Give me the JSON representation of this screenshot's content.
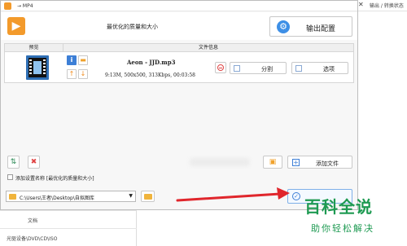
{
  "window": {
    "title": "→ MP4"
  },
  "background_app": {
    "top_right_text": "输出 / 转换状态",
    "left_items": [
      "文档",
      "光驱设备\\DVD\\CD\\ISO"
    ]
  },
  "header": {
    "preset_name": "最优化的质量和大小",
    "output_config_label": "输出配置"
  },
  "list": {
    "columns": [
      "预览",
      "文件信息"
    ],
    "rows": [
      {
        "file_name": "Aeon - JJD.mp3",
        "meta": "9:13M, 500x500, 313Kbps, 00:03:58",
        "split_label": "分割",
        "options_label": "选项"
      }
    ]
  },
  "toolbar": {
    "add_file_label": "添加文件"
  },
  "save_preset": {
    "label": "添加设置名称 [最优化的质量和大小]",
    "checked": false
  },
  "output": {
    "directory": "C:\\Users\\王者\\Desktop\\自拟图库"
  },
  "watermark": {
    "main": "百科全说",
    "sub": "助你轻松解决"
  },
  "colors": {
    "accent_orange": "#f39a2b",
    "accent_blue": "#3d7fd6",
    "arrow_red": "#e0262c",
    "watermark_green": "#1e9a52"
  }
}
